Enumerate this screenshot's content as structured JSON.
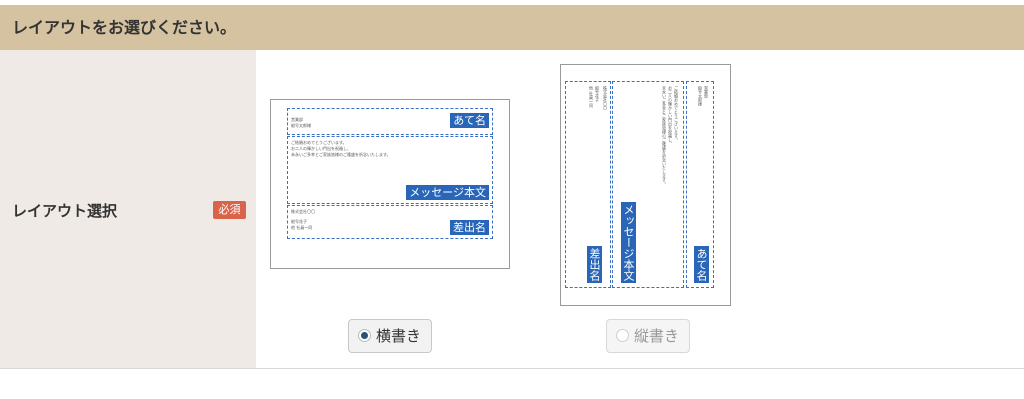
{
  "header": {
    "title": "レイアウトをお選びください。"
  },
  "row": {
    "label": "レイアウト選択",
    "required_badge": "必須"
  },
  "horizontal_preview": {
    "to_tag": "あて名",
    "message_tag": "メッセージ本文",
    "from_tag": "差出名",
    "to_lines": [
      "営業部",
      "縦号太郎様"
    ],
    "message_lines": [
      "ご結婚おめでとうございます。",
      "お二人の輝かしい門出を祝福し、",
      "未永いご多幸とご家族皆様のご隆盛を祈念いたします。"
    ],
    "from_lines": [
      "株式会社〇〇",
      "縦号花子",
      "他 社員一同"
    ]
  },
  "vertical_preview": {
    "to_tag": "あて名",
    "message_tag": "メッセージ本文",
    "from_tag": "差出名",
    "to_lines": [
      "営業部",
      "縦号太郎様"
    ],
    "message_lines": [
      "ご結婚おめでとうございます。",
      "お二人の輝かしい門出を祝福し、",
      "未永いご多幸とご家族皆様のご隆盛を祈念いたします。"
    ],
    "from_lines": [
      "株式会社〇〇",
      "縦号花子",
      "他 社員一同"
    ]
  },
  "options": {
    "horizontal_label": "横書き",
    "vertical_label": "縦書き",
    "selected": "横書き"
  },
  "colors": {
    "header_bg": "#d5c2a1",
    "label_bg": "#efeae5",
    "badge": "#d9644a",
    "tag_blue": "#2a66b8"
  }
}
